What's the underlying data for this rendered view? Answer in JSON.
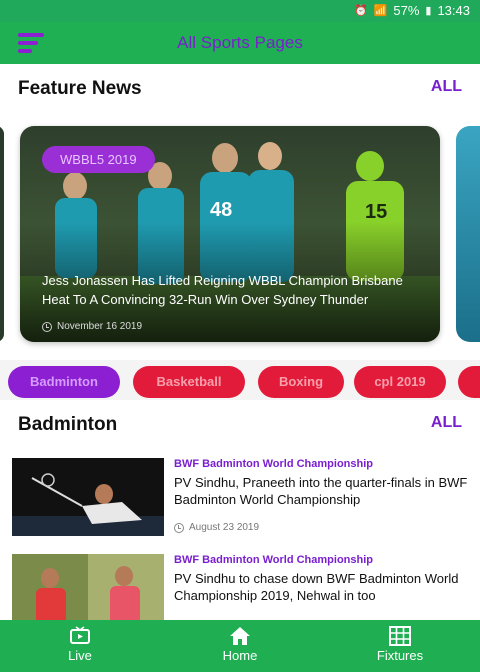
{
  "status_bar": {
    "battery": "57%",
    "time": "13:43"
  },
  "app_bar": {
    "title": "All Sports Pages"
  },
  "feature": {
    "title": "Feature News",
    "all_label": "ALL",
    "card": {
      "badge": "WBBL5 2019",
      "headline": "Jess Jonassen Has Lifted Reigning WBBL Champion Brisbane Heat To A Convincing 32-Run Win Over Sydney Thunder",
      "date": "November 16 2019",
      "jersey_left": "48",
      "jersey_right": "15"
    }
  },
  "categories": [
    "Badminton",
    "Basketball",
    "Boxing",
    "cpl 2019"
  ],
  "badminton": {
    "title": "Badminton",
    "all_label": "ALL",
    "items": [
      {
        "category": "BWF Badminton World Championship",
        "title": "PV Sindhu, Praneeth into the quarter-finals in BWF Badminton World Championship",
        "date": "August 23 2019"
      },
      {
        "category": "BWF Badminton World Championship",
        "title": "PV Sindhu to chase down BWF Badminton World Championship 2019, Nehwal in too",
        "date": ""
      }
    ]
  },
  "bottom_nav": {
    "live": "Live",
    "home": "Home",
    "fixtures": "Fixtures"
  },
  "colors": {
    "green": "#1fb053",
    "purple": "#8b1fd1",
    "red": "#e31b3a"
  }
}
